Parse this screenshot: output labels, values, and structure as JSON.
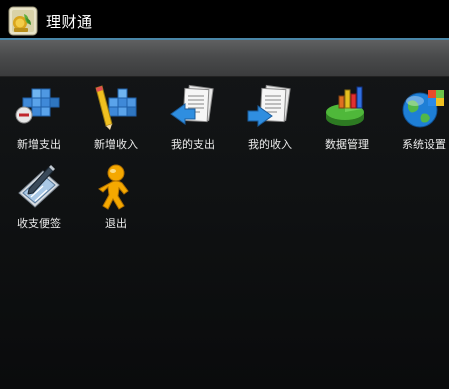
{
  "app": {
    "title": "理财通",
    "icon": "finance-app-icon"
  },
  "menu": {
    "items": [
      {
        "label": "新增支出",
        "icon": "add-expense-icon"
      },
      {
        "label": "新增收入",
        "icon": "add-income-icon"
      },
      {
        "label": "我的支出",
        "icon": "my-expense-icon"
      },
      {
        "label": "我的收入",
        "icon": "my-income-icon"
      },
      {
        "label": "数据管理",
        "icon": "data-management-icon"
      },
      {
        "label": "系统设置",
        "icon": "system-settings-icon"
      },
      {
        "label": "收支便签",
        "icon": "notes-icon"
      },
      {
        "label": "退出",
        "icon": "exit-icon"
      }
    ]
  }
}
